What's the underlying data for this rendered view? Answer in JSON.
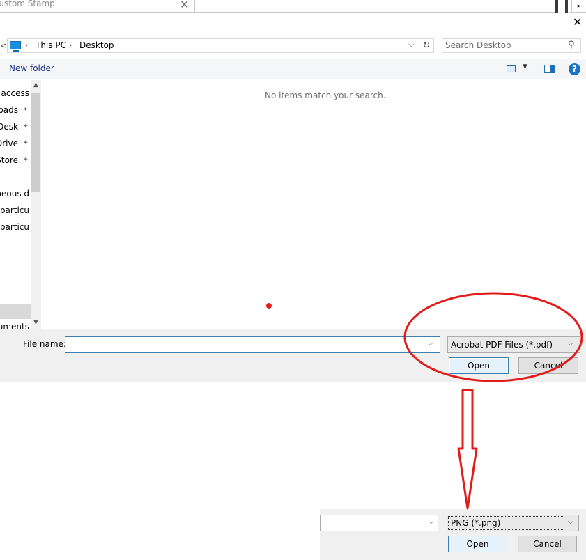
{
  "top": {
    "tab_label": "Custom Stamp",
    "tab_close": "✕",
    "arrow": "▸"
  },
  "dialog": {
    "close": "✕"
  },
  "address": {
    "back": "<",
    "sep": "›",
    "crumbs": [
      "This PC",
      "Desktop"
    ],
    "dropdown": "⌵",
    "refresh": "↻",
    "search_placeholder": "Search Desktop",
    "search_icon": "⚲"
  },
  "toolbar": {
    "new_folder": "New folder",
    "view_dropdown": "▼",
    "help": "?"
  },
  "nav": {
    "items": [
      {
        "label": "Quick access",
        "pinned": false
      },
      {
        "label": "Downloads",
        "pinned": true
      },
      {
        "label": "Desk",
        "pinned": true
      },
      {
        "label": "OneDrive",
        "pinned": true
      },
      {
        "label": "Store",
        "pinned": true
      },
      {
        "label": "Miscellaneous d",
        "pinned": false
      },
      {
        "label": "Small particu",
        "pinned": false
      },
      {
        "label": "Small particu",
        "pinned": false
      },
      {
        "label": "Documents",
        "pinned": false
      }
    ],
    "pin_icon": "📌",
    "scroll_up": "▲",
    "scroll_down": "▼"
  },
  "content": {
    "empty_message": "No items match your search."
  },
  "bottom": {
    "filename_label": "File name:",
    "filename_value": "",
    "dropdown": "⌵",
    "file_type": "Acrobat PDF Files (*.pdf)",
    "open_label": "Open",
    "cancel_label": "Cancel"
  },
  "inset": {
    "file_type": "PNG (*.png)",
    "open_label": "Open",
    "cancel_label": "Cancel",
    "dropdown": "⌵"
  },
  "colors": {
    "annotation_red": "#e21b1b",
    "accent_blue": "#1e3287",
    "focus_border": "#3c7fb1"
  }
}
